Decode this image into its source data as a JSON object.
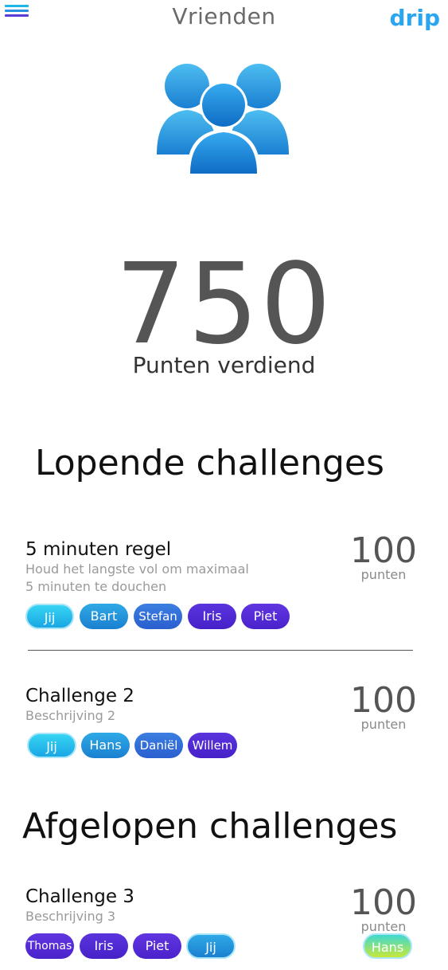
{
  "header": {
    "title": "Vrienden",
    "brand": "drip",
    "menu_icon": "hamburger-menu-icon"
  },
  "hero": {
    "icon": "users-group-icon",
    "points": "750",
    "points_label": "Punten verdiend"
  },
  "sections": {
    "running_title": "Lopende challenges",
    "finished_title": "Afgelopen challenges"
  },
  "challenges": [
    {
      "name": "5 minuten regel",
      "description_line1": "Houd het langste vol om maximaal",
      "description_line2": "5 minuten te douchen",
      "points": "100",
      "points_label": "punten",
      "participants": [
        "Jij",
        "Bart",
        "Stefan",
        "Iris",
        "Piet"
      ]
    },
    {
      "name": "Challenge 2",
      "description_line1": "Beschrijving 2",
      "points": "100",
      "points_label": "punten",
      "participants": [
        "Jij",
        "Hans",
        "Daniël",
        "Willem"
      ]
    },
    {
      "name": "Challenge 3",
      "description_line1": "Beschrijving 3",
      "points": "100",
      "points_label": "punten",
      "participants": [
        "Thomas",
        "Iris",
        "Piet",
        "Jij"
      ],
      "winner": "Hans"
    }
  ],
  "colors": {
    "accent": "#2aa6f0",
    "text": "#111111",
    "muted": "#9a9a9a"
  }
}
